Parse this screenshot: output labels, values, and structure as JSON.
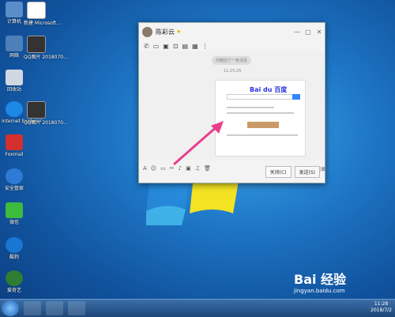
{
  "desktop": {
    "icons": [
      {
        "label": "计算机",
        "icon": "computer-icon"
      },
      {
        "label": "新建 Microsoft...",
        "icon": "document-icon"
      },
      {
        "label": "网络",
        "icon": "network-icon"
      },
      {
        "label": "QQ图片 2018070...",
        "icon": "image-icon"
      },
      {
        "label": "回收站",
        "icon": "recycle-bin-icon"
      },
      {
        "label": "Internet Explorer",
        "icon": "ie-icon"
      },
      {
        "label": "QQ图片 2018070...",
        "icon": "image-icon"
      },
      {
        "label": "Foxmail",
        "icon": "foxmail-icon"
      },
      {
        "label": "安全管家",
        "icon": "security-icon"
      },
      {
        "label": "微信",
        "icon": "wechat-icon"
      },
      {
        "label": "酷狗",
        "icon": "kugou-icon"
      },
      {
        "label": "爱奇艺",
        "icon": "iqiyi-icon"
      }
    ]
  },
  "chat": {
    "title": "陈彩云",
    "system_msg": "你撤回了一条消息",
    "time": "11:25:25",
    "screenshot_brand": "Bai du 百度",
    "history": "消息记录",
    "close_label": "关闭(C)",
    "send_label": "发送(S)"
  },
  "taskbar": {
    "time": "11:28",
    "date": "2018/7/2"
  },
  "watermark": {
    "logo": "Bai 经验",
    "url": "jingyan.baidu.com"
  }
}
